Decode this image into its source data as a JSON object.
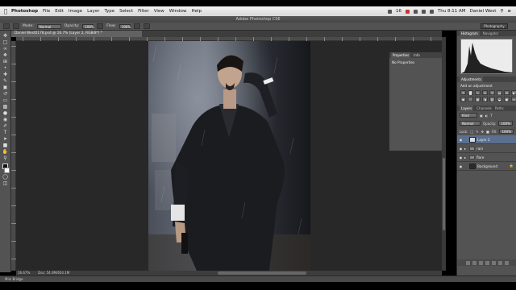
{
  "menubar": {
    "apple_icon": "apple-icon",
    "items": [
      "Photoshop",
      "File",
      "Edit",
      "Image",
      "Layer",
      "Type",
      "Select",
      "Filter",
      "View",
      "Window",
      "Help"
    ],
    "tray_badge": "16",
    "clock": "Thu 8:11 AM",
    "user": "Daniel West"
  },
  "app_title": "Adobe Photoshop CS6",
  "options": {
    "mode_label": "Mode:",
    "mode_value": "Normal",
    "opacity_label": "Opacity:",
    "opacity_value": "100%",
    "flow_label": "Flow:",
    "flow_value": "100%",
    "workspace": "Photography"
  },
  "document": {
    "tab_title": "Daniel West0178.psd @ 16.7% (Layer 2, RGB/8*) *",
    "zoom": "16.67%",
    "doc_size": "Doc: 54.0M/654.1M"
  },
  "properties_panel": {
    "tabs": [
      "Properties",
      "Info"
    ],
    "body": "No Properties"
  },
  "histogram_panel": {
    "tabs": [
      "Histogram",
      "Navigator"
    ]
  },
  "adjustments_panel": {
    "tabs": [
      "Adjustments"
    ],
    "title": "Add an adjustment"
  },
  "layers_panel": {
    "tabs": [
      "Layers",
      "Channels",
      "Paths"
    ],
    "kind_label": "Kind",
    "blend_mode": "Normal",
    "opacity_label": "Opacity:",
    "opacity_value": "100%",
    "lock_label": "Lock:",
    "fill_label": "Fill:",
    "fill_value": "100%",
    "layers": [
      {
        "name": "Layer 2",
        "selected": true,
        "type": "layer"
      },
      {
        "name": "rain",
        "selected": false,
        "type": "group"
      },
      {
        "name": "flare",
        "selected": false,
        "type": "group"
      },
      {
        "name": "Background",
        "selected": false,
        "type": "background"
      }
    ]
  },
  "mini_bridge": "Mini Bridge",
  "colors": {
    "panel_bg": "#535353",
    "canvas_bg": "#282828",
    "selection": "#5b6f8e"
  }
}
